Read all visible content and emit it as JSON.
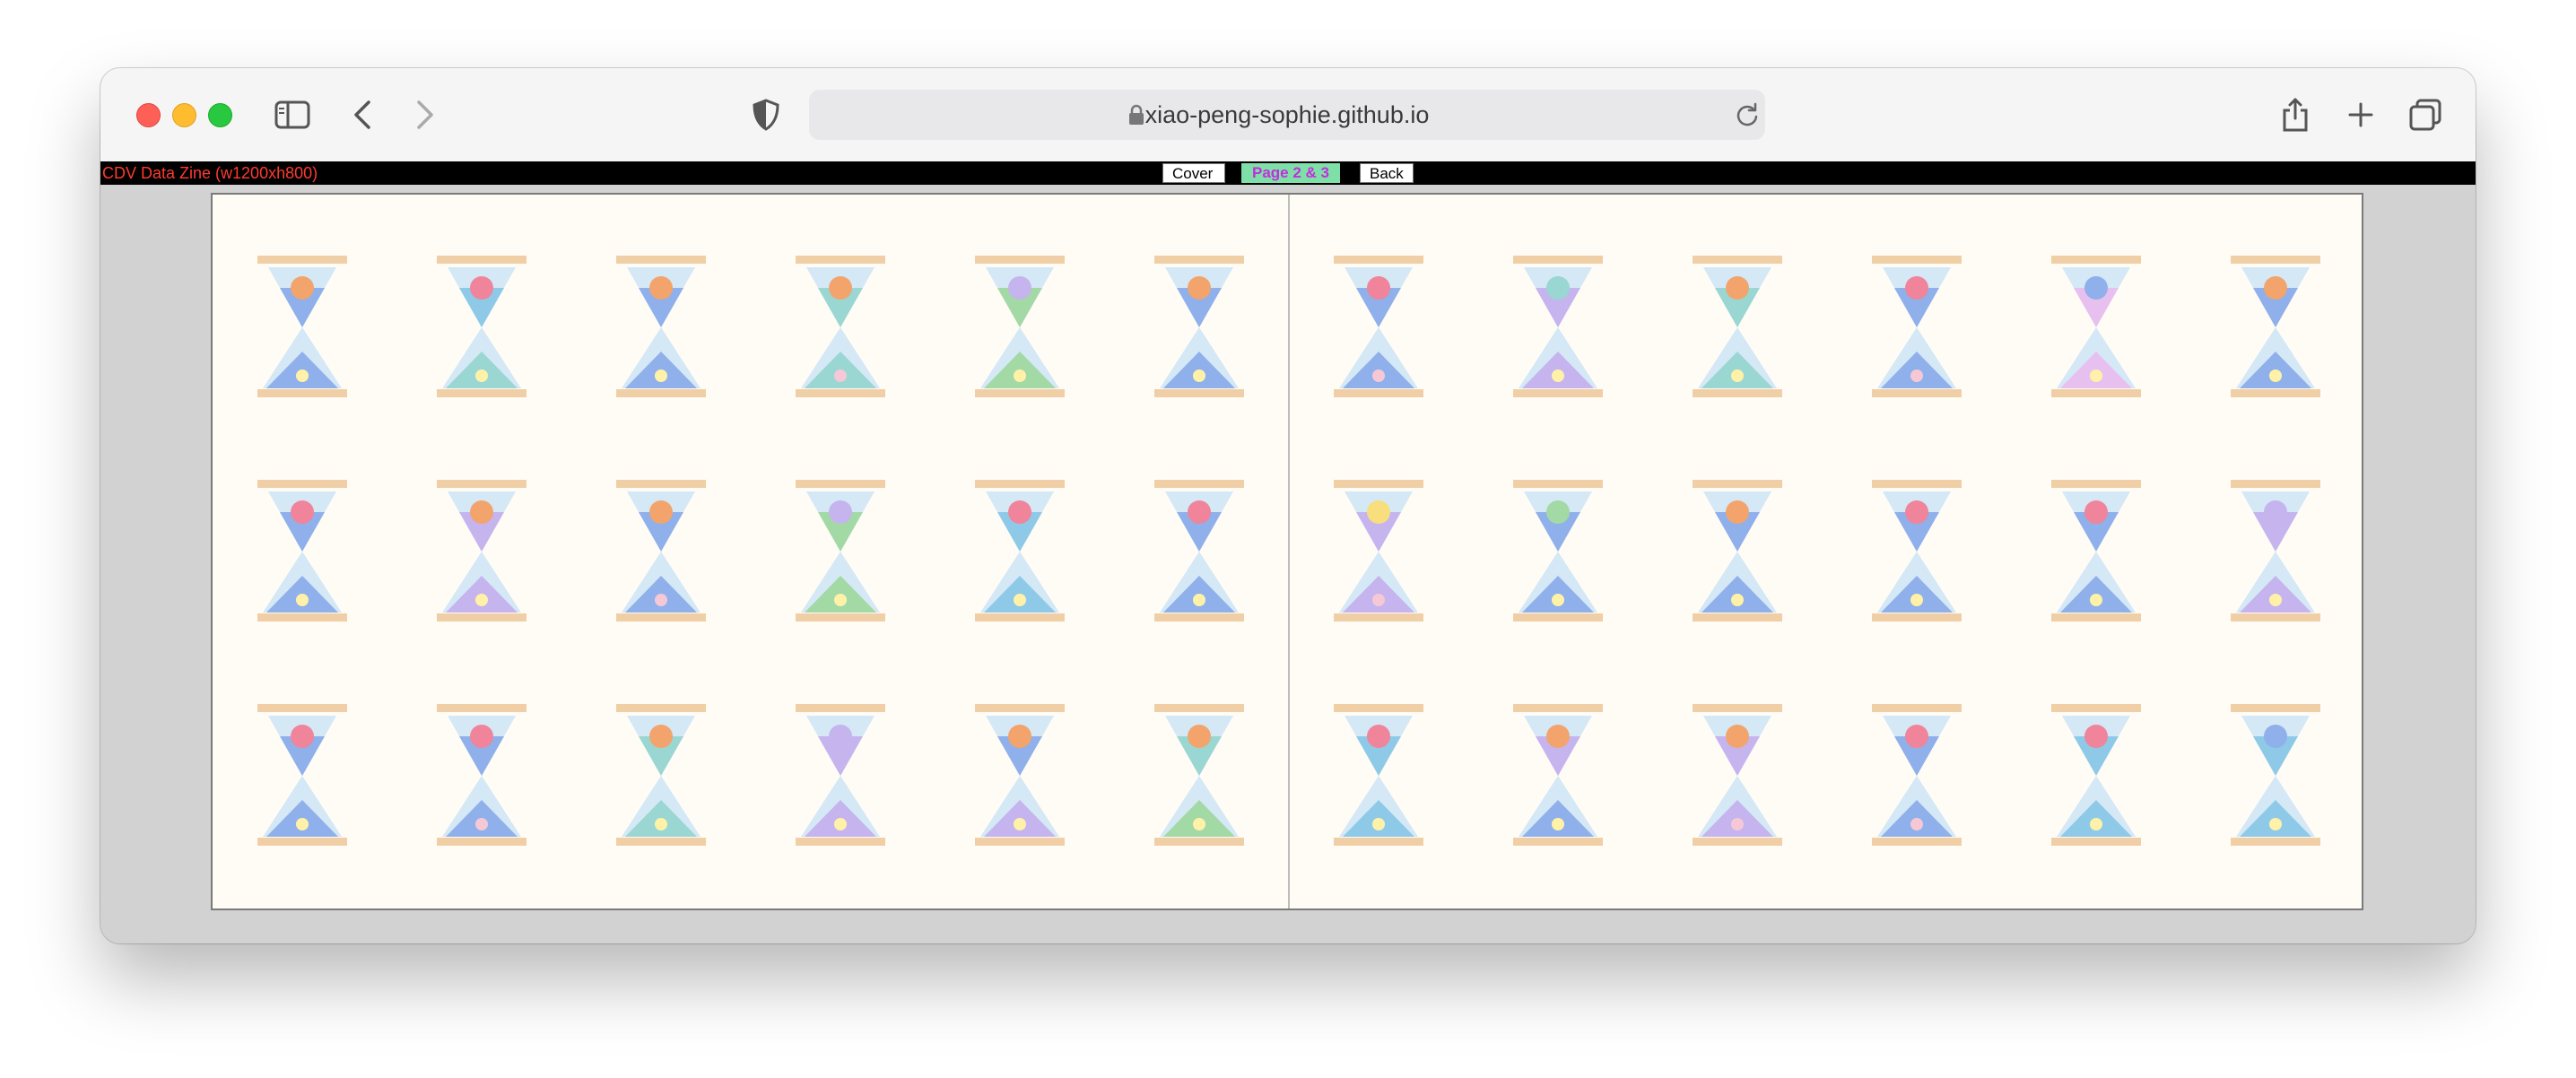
{
  "browser": {
    "url": "xiao-peng-sophie.github.io",
    "icons": [
      "sidebar-icon",
      "back-arrow-icon",
      "forward-arrow-icon",
      "privacy-shield-icon",
      "lock-icon",
      "reload-icon",
      "share-icon",
      "new-tab-plus-icon",
      "tab-overview-icon"
    ]
  },
  "zine": {
    "label": "CDV Data Zine (w1200xh800)",
    "nav": {
      "cover": "Cover",
      "current_page": "Page 2 & 3",
      "back": "Back"
    }
  },
  "colors": {
    "frame": "#f1cfa6",
    "glass": "#d5e8f6",
    "palette": {
      "orange": "#f2a46c",
      "pink": "#f0849a",
      "yellow": "#f8de7c",
      "green": "#a3d9a5",
      "teal": "#9ad6d2",
      "blue": "#8fb0ea",
      "lavender": "#c5b4ee",
      "lightpink": "#e8c0ef",
      "skyblue": "#8ecae8",
      "cream": "#fff2a8"
    }
  },
  "hourglasses": [
    {
      "ball": "orange",
      "top": "blue",
      "bottom": "blue",
      "dot": "yellow"
    },
    {
      "ball": "pink",
      "top": "skyblue",
      "bottom": "teal",
      "dot": "yellow"
    },
    {
      "ball": "orange",
      "top": "blue",
      "bottom": "blue",
      "dot": "yellow"
    },
    {
      "ball": "orange",
      "top": "teal",
      "bottom": "teal",
      "dot": "pink"
    },
    {
      "ball": "lavender",
      "top": "green",
      "bottom": "green",
      "dot": "yellow"
    },
    {
      "ball": "orange",
      "top": "blue",
      "bottom": "blue",
      "dot": "yellow"
    },
    {
      "ball": "pink",
      "top": "blue",
      "bottom": "blue",
      "dot": "pink"
    },
    {
      "ball": "teal",
      "top": "lavender",
      "bottom": "lavender",
      "dot": "yellow"
    },
    {
      "ball": "orange",
      "top": "teal",
      "bottom": "teal",
      "dot": "yellow"
    },
    {
      "ball": "pink",
      "top": "blue",
      "bottom": "blue",
      "dot": "pink"
    },
    {
      "ball": "blue",
      "top": "lightpink",
      "bottom": "lightpink",
      "dot": "yellow"
    },
    {
      "ball": "orange",
      "top": "blue",
      "bottom": "blue",
      "dot": "yellow"
    },
    {
      "ball": "pink",
      "top": "blue",
      "bottom": "blue",
      "dot": "yellow"
    },
    {
      "ball": "orange",
      "top": "lavender",
      "bottom": "lavender",
      "dot": "yellow"
    },
    {
      "ball": "orange",
      "top": "blue",
      "bottom": "blue",
      "dot": "pink"
    },
    {
      "ball": "lavender",
      "top": "green",
      "bottom": "green",
      "dot": "yellow"
    },
    {
      "ball": "pink",
      "top": "skyblue",
      "bottom": "skyblue",
      "dot": "yellow"
    },
    {
      "ball": "pink",
      "top": "blue",
      "bottom": "blue",
      "dot": "yellow"
    },
    {
      "ball": "yellow",
      "top": "lavender",
      "bottom": "lavender",
      "dot": "pink"
    },
    {
      "ball": "green",
      "top": "blue",
      "bottom": "blue",
      "dot": "yellow"
    },
    {
      "ball": "orange",
      "top": "blue",
      "bottom": "blue",
      "dot": "yellow"
    },
    {
      "ball": "pink",
      "top": "blue",
      "bottom": "blue",
      "dot": "yellow"
    },
    {
      "ball": "pink",
      "top": "blue",
      "bottom": "blue",
      "dot": "yellow"
    },
    {
      "ball": "lavender",
      "top": "lavender",
      "bottom": "lavender",
      "dot": "yellow"
    },
    {
      "ball": "pink",
      "top": "blue",
      "bottom": "blue",
      "dot": "yellow"
    },
    {
      "ball": "pink",
      "top": "blue",
      "bottom": "blue",
      "dot": "pink"
    },
    {
      "ball": "orange",
      "top": "teal",
      "bottom": "teal",
      "dot": "yellow"
    },
    {
      "ball": "lavender",
      "top": "lavender",
      "bottom": "lavender",
      "dot": "yellow"
    },
    {
      "ball": "orange",
      "top": "blue",
      "bottom": "lavender",
      "dot": "yellow"
    },
    {
      "ball": "orange",
      "top": "teal",
      "bottom": "green",
      "dot": "yellow"
    },
    {
      "ball": "pink",
      "top": "skyblue",
      "bottom": "skyblue",
      "dot": "yellow"
    },
    {
      "ball": "orange",
      "top": "lavender",
      "bottom": "blue",
      "dot": "yellow"
    },
    {
      "ball": "orange",
      "top": "lavender",
      "bottom": "lavender",
      "dot": "pink"
    },
    {
      "ball": "pink",
      "top": "blue",
      "bottom": "blue",
      "dot": "pink"
    },
    {
      "ball": "pink",
      "top": "skyblue",
      "bottom": "skyblue",
      "dot": "yellow"
    },
    {
      "ball": "blue",
      "top": "skyblue",
      "bottom": "skyblue",
      "dot": "yellow"
    }
  ]
}
